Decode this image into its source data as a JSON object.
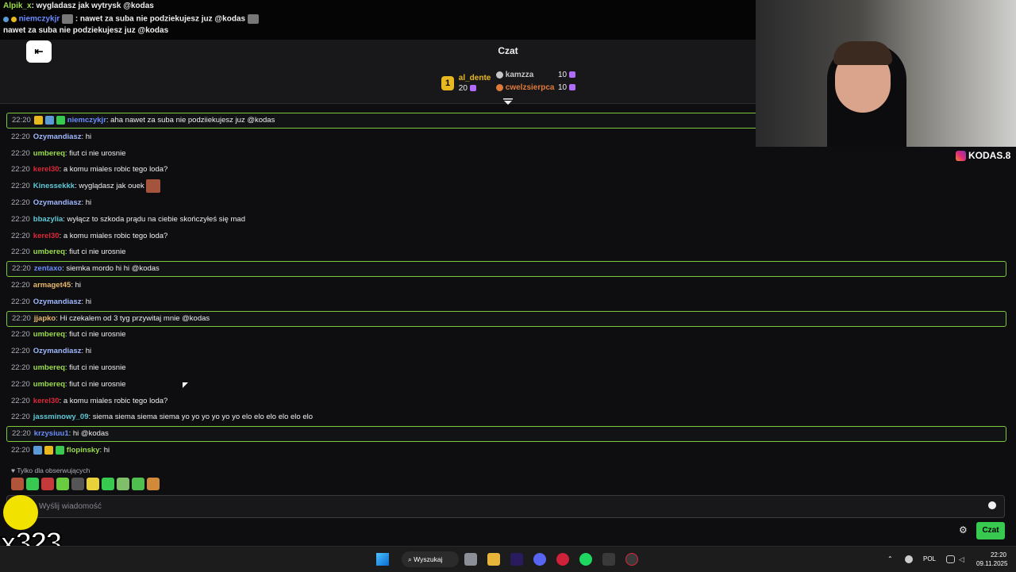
{
  "overlay": {
    "line1_user": "Alpik_x",
    "line1_text": ": wygladasz jak wytrysk @kodas",
    "line2_user": "niemczykjr",
    "line2_text": ": nawet za suba nie podziekujesz juz @kodas",
    "line3_text": "nawet za suba nie podziekujesz juz @kodas"
  },
  "header": {
    "title": "Czat",
    "leaders": [
      {
        "rank": "1",
        "name": "al_dente",
        "points": "20",
        "color": "#e8b81f"
      },
      {
        "rank": "2",
        "name": "kamzza",
        "points": "10",
        "color": "#c5c5c5"
      },
      {
        "rank": "3",
        "name": "cwelzsierpca",
        "points": "10",
        "color": "#e07a3a"
      }
    ]
  },
  "messages": [
    {
      "time": "22:20",
      "user": "niemczykjr",
      "text": ": aha nawet za suba nie podziiekujesz juz @kodas",
      "color": "#6b8cff",
      "highlight": true,
      "badges": [
        "#e8b81f",
        "#5b9bd5",
        "#37c950"
      ]
    },
    {
      "time": "22:20",
      "user": "Ozymandiasz",
      "text": ": hi",
      "color": "#9fb8ff",
      "highlight": false
    },
    {
      "time": "22:20",
      "user": "umbereq",
      "text": ": fiut ci nie urosnie",
      "color": "#9bdc4b",
      "highlight": false
    },
    {
      "time": "22:20",
      "user": "kerel30",
      "text": ": a komu miales robic tego loda?",
      "color": "#e0263a",
      "highlight": false
    },
    {
      "time": "22:20",
      "user": "Kinessekkk",
      "text": ": wyglądasz jak ouek",
      "color": "#5ec8d6",
      "highlight": false,
      "emote": true
    },
    {
      "time": "22:20",
      "user": "Ozymandiasz",
      "text": ": hi",
      "color": "#9fb8ff",
      "highlight": false
    },
    {
      "time": "22:20",
      "user": "bbazylia",
      "text": ": wyłącz to szkoda prądu na ciebie skończyłeś się mad",
      "color": "#5ec8d6",
      "highlight": false
    },
    {
      "time": "22:20",
      "user": "kerel30",
      "text": ": a komu miales robic tego loda?",
      "color": "#e0263a",
      "highlight": false
    },
    {
      "time": "22:20",
      "user": "umbereq",
      "text": ": fiut ci nie urosnie",
      "color": "#9bdc4b",
      "highlight": false
    },
    {
      "time": "22:20",
      "user": "zentaxo",
      "text": ": siemka mordo hi hi @kodas",
      "color": "#6b8cff",
      "highlight": true
    },
    {
      "time": "22:20",
      "user": "armaget45",
      "text": ": hi",
      "color": "#e8b86a",
      "highlight": false
    },
    {
      "time": "22:20",
      "user": "Ozymandiasz",
      "text": ": hi",
      "color": "#9fb8ff",
      "highlight": false
    },
    {
      "time": "22:20",
      "user": "jjapko",
      "text": ": Hi czekalem od 3 tyg przywitaj mnie @kodas",
      "color": "#e8b86a",
      "highlight": true
    },
    {
      "time": "22:20",
      "user": "umbereq",
      "text": ": fiut ci nie urosnie",
      "color": "#9bdc4b",
      "highlight": false
    },
    {
      "time": "22:20",
      "user": "Ozymandiasz",
      "text": ": hi",
      "color": "#9fb8ff",
      "highlight": false
    },
    {
      "time": "22:20",
      "user": "umbereq",
      "text": ": fiut ci nie urosnie",
      "color": "#9bdc4b",
      "highlight": false
    },
    {
      "time": "22:20",
      "user": "umbereq",
      "text": ": fiut ci nie urosnie",
      "color": "#9bdc4b",
      "highlight": false
    },
    {
      "time": "22:20",
      "user": "kerel30",
      "text": ": a komu miales robic tego loda?",
      "color": "#e0263a",
      "highlight": false
    },
    {
      "time": "22:20",
      "user": "jassminowy_09",
      "text": ": siema siema siema siema yo yo yo yo yo yo elo elo elo elo elo elo",
      "color": "#5ec8d6",
      "highlight": false
    },
    {
      "time": "22:20",
      "user": "krzysiuu1",
      "text": ": hi @kodas",
      "color": "#6b8cff",
      "highlight": true
    },
    {
      "time": "22:20",
      "user": "flopinsky",
      "text": ": hi",
      "color": "#9bdc4b",
      "highlight": false,
      "badges": [
        "#5b9bd5",
        "#e8b81f",
        "#37c950"
      ]
    }
  ],
  "followers_label": "Tylko dla obserwujących",
  "input": {
    "placeholder": "Wyślij wiadomość"
  },
  "send_label": "Czat",
  "instagram": "KODAS.8",
  "overlay_counter": "x323",
  "taskbar": {
    "search_label": "Wyszukaj",
    "lang": "POL",
    "time": "22:20",
    "date": "09.11.2025"
  }
}
